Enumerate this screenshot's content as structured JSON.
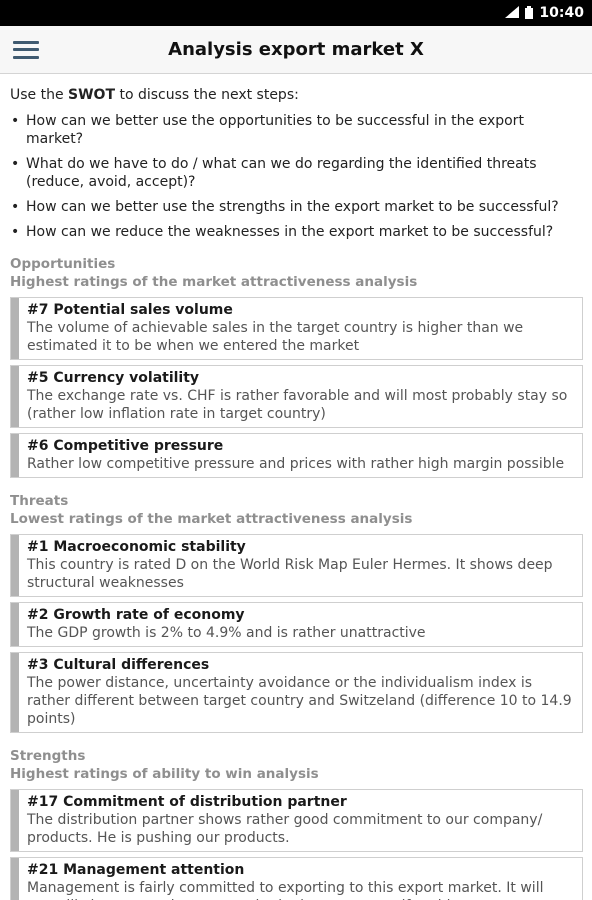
{
  "status_bar": {
    "time": "10:40",
    "icons": [
      "signal-icon",
      "battery-icon"
    ]
  },
  "app_bar": {
    "title": "Analysis export market X",
    "menu_icon": "hamburger-menu-icon"
  },
  "intro": {
    "prefix": "Use the ",
    "emphasis": "SWOT",
    "suffix": " to discuss the next steps:"
  },
  "questions": [
    "How can we better use the opportunities to be successful in the export market?",
    "What do we have to do / what can we do regarding the identified threats (reduce, avoid, accept)?",
    "How can we better use the strengths in the export market to be successful?",
    "How can we reduce the weaknesses in the export market to be successful?"
  ],
  "sections": [
    {
      "heading": "Opportunities",
      "subheading": "Highest ratings of the market attractiveness analysis",
      "cards": [
        {
          "title": "#7 Potential sales volume",
          "text": "The volume of achievable sales in the target country is higher than we estimated it to be when we entered the market"
        },
        {
          "title": "#5 Currency volatility",
          "text": "The exchange rate vs. CHF is rather  favorable and will most probably stay so (rather low inflation rate in target country)"
        },
        {
          "title": "#6 Competitive pressure",
          "text": "Rather low competitive pressure and prices with rather high margin possible"
        }
      ]
    },
    {
      "heading": "Threats",
      "subheading": "Lowest ratings of the market attractiveness analysis",
      "cards": [
        {
          "title": "#1 Macroeconomic stability",
          "text": "This country is rated D on the World Risk Map Euler Hermes. It shows deep structural weaknesses"
        },
        {
          "title": "#2 Growth rate of economy",
          "text": "The GDP growth is 2% to 4.9% and is rather unattractive"
        },
        {
          "title": "#3 Cultural differences",
          "text": "The power distance, uncertainty avoidance or the individualism index is rather different between target country and Switzeland (difference 10 to 14.9 points)"
        }
      ]
    },
    {
      "heading": "Strengths",
      "subheading": "Highest ratings of ability to win analysis",
      "cards": [
        {
          "title": "#17 Commitment of distribution partner",
          "text": "The distribution partner shows rather good commitment to our company/ products. He is pushing our products."
        },
        {
          "title": "#21 Management attention",
          "text": "Management is fairly committed to exporting to this export market. It will most likely support the strategy in the long run even if problems occur"
        }
      ]
    }
  ]
}
